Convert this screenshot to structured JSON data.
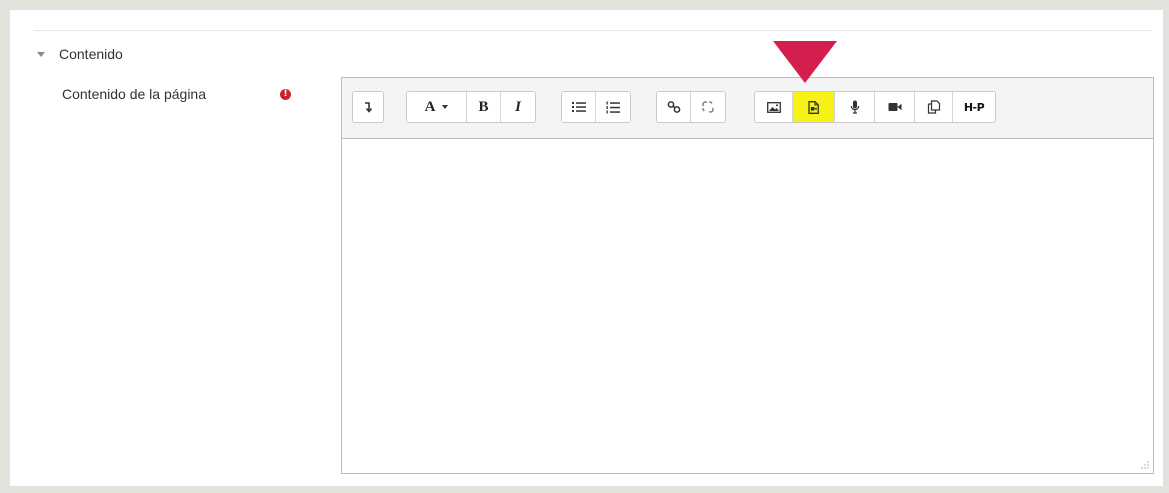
{
  "section": {
    "title": "Contenido",
    "collapse_icon": "caret-down-icon"
  },
  "field": {
    "label": "Contenido de la página",
    "required_icon": "exclamation-circle-icon",
    "required_symbol": "!",
    "required_color": "#c9242b"
  },
  "toolbar": {
    "font_style_label": "A",
    "bold_label": "B",
    "italic_label": "I",
    "h5p_label": "H-P",
    "buttons": [
      {
        "name": "collapse-toolbar-button",
        "icon": "arrow-down-turn-icon"
      },
      {
        "name": "font-style-button",
        "icon": "text-style-icon"
      },
      {
        "name": "bold-button",
        "icon": "bold-icon"
      },
      {
        "name": "italic-button",
        "icon": "italic-icon"
      },
      {
        "name": "unordered-list-button",
        "icon": "bullet-list-icon"
      },
      {
        "name": "ordered-list-button",
        "icon": "numbered-list-icon"
      },
      {
        "name": "link-button",
        "icon": "link-icon"
      },
      {
        "name": "unlink-button",
        "icon": "unlink-icon"
      },
      {
        "name": "insert-image-button",
        "icon": "image-icon"
      },
      {
        "name": "insert-media-button",
        "icon": "media-file-icon",
        "highlighted": true
      },
      {
        "name": "record-audio-button",
        "icon": "microphone-icon"
      },
      {
        "name": "record-video-button",
        "icon": "video-camera-icon"
      },
      {
        "name": "manage-files-button",
        "icon": "copy-files-icon"
      },
      {
        "name": "insert-h5p-button",
        "icon": "h5p-icon"
      }
    ]
  },
  "editor": {
    "content": ""
  },
  "colors": {
    "highlight": "#f6f214",
    "pointer_arrow": "#d41f4e",
    "background": "#e4e2dd"
  }
}
